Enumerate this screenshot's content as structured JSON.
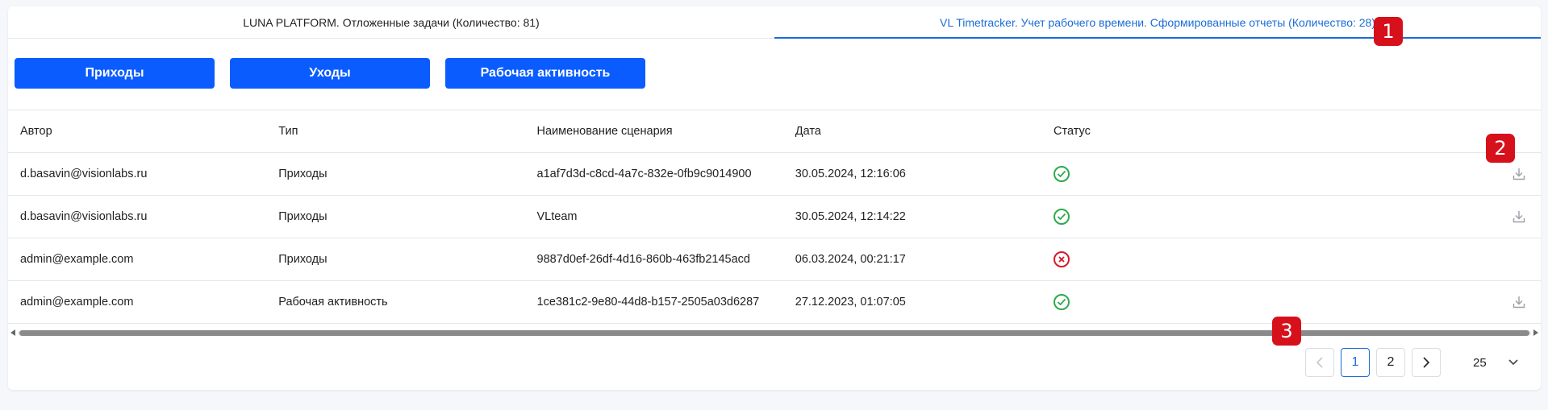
{
  "tabs": [
    {
      "label": "LUNA PLATFORM. Отложенные задачи (Количество: 81)",
      "active": false
    },
    {
      "label": "VL Timetracker. Учет рабочего времени. Сформированные отчеты (Количество: 28)",
      "active": true
    }
  ],
  "buttons": {
    "arrivals": "Приходы",
    "departures": "Уходы",
    "activity": "Рабочая активность"
  },
  "table": {
    "headers": {
      "author": "Автор",
      "type": "Тип",
      "scenario": "Наименование сценария",
      "date": "Дата",
      "status": "Статус"
    },
    "rows": [
      {
        "author": "d.basavin@visionlabs.ru",
        "type": "Приходы",
        "scenario": "a1af7d3d-c8cd-4a7c-832e-0fb9c9014900",
        "date": "30.05.2024, 12:16:06",
        "status": "success",
        "download": true
      },
      {
        "author": "d.basavin@visionlabs.ru",
        "type": "Приходы",
        "scenario": "VLteam",
        "date": "30.05.2024, 12:14:22",
        "status": "success",
        "download": true
      },
      {
        "author": "admin@example.com",
        "type": "Приходы",
        "scenario": "9887d0ef-26df-4d16-860b-463fb2145acd",
        "date": "06.03.2024, 00:21:17",
        "status": "error",
        "download": false
      },
      {
        "author": "admin@example.com",
        "type": "Рабочая активность",
        "scenario": "1ce381c2-9e80-44d8-b157-2505a03d6287",
        "date": "27.12.2023, 01:07:05",
        "status": "success",
        "download": true
      }
    ]
  },
  "pagination": {
    "pages": [
      "1",
      "2"
    ],
    "current": "1",
    "per_page": "25"
  },
  "markers": [
    "1",
    "2",
    "3"
  ],
  "colors": {
    "accent": "#1a6cd8",
    "button": "#0a5cff",
    "success": "#2eaa4b",
    "error": "#d9182a",
    "marker": "#d7111c"
  },
  "icons": {
    "success": "check-circle-icon",
    "error": "x-circle-icon",
    "download": "download-icon",
    "prev": "chevron-left-icon",
    "next": "chevron-right-icon",
    "dropdown": "chevron-down-icon"
  }
}
